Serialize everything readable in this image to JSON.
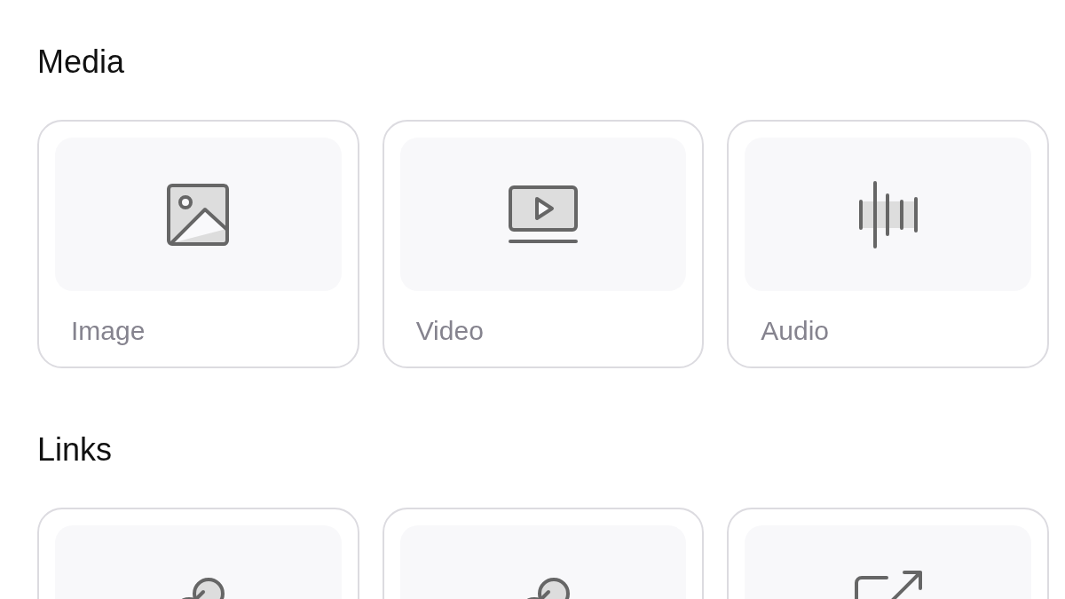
{
  "sections": [
    {
      "title": "Media",
      "cards": [
        {
          "kind": "image",
          "label": "Image"
        },
        {
          "kind": "video",
          "label": "Video"
        },
        {
          "kind": "audio",
          "label": "Audio"
        }
      ]
    },
    {
      "title": "Links",
      "cards": [
        {
          "kind": "link"
        },
        {
          "kind": "link"
        },
        {
          "kind": "external"
        }
      ]
    }
  ]
}
